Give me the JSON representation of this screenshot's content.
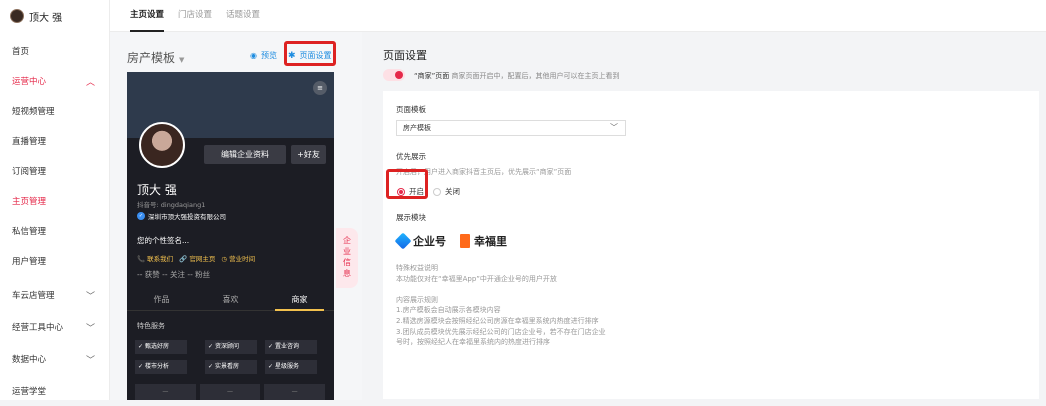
{
  "user": {
    "name": "顶大 强"
  },
  "sidebar": {
    "items": [
      {
        "label": "首页"
      },
      {
        "label": "运营中心",
        "chevron": "up"
      },
      {
        "label": "短视频管理"
      },
      {
        "label": "直播管理"
      },
      {
        "label": "订阅管理"
      },
      {
        "label": "主页管理"
      },
      {
        "label": "私信管理"
      },
      {
        "label": "用户管理"
      },
      {
        "label": "车云店管理",
        "chevron": "down"
      },
      {
        "label": "经营工具中心",
        "chevron": "down"
      },
      {
        "label": "数据中心",
        "chevron": "down"
      },
      {
        "label": "运营学堂"
      }
    ]
  },
  "tabs": [
    {
      "label": "主页设置"
    },
    {
      "label": "门店设置"
    },
    {
      "label": "话题设置"
    }
  ],
  "left": {
    "template_title": "房产模板",
    "preview_label": "预览",
    "page_settings_label": "页面设置"
  },
  "phone": {
    "edit_button": "编辑企业资料",
    "friend_button": "+好友",
    "name": "顶大 强",
    "douyin_id": "抖音号: dingdaqiang1",
    "company": "深圳市顶大强投资有限公司",
    "signature": "您的个性签名...",
    "links": [
      "联系我们",
      "官网主页",
      "营业时间"
    ],
    "stats": "-- 获赞   -- 关注   -- 粉丝",
    "tabs": [
      "作品",
      "喜欢",
      "商家"
    ],
    "services_title": "特色服务",
    "services": [
      "甄选好房",
      "资深顾问",
      "置业咨询",
      "楼市分析",
      "实景看房",
      "星级服务"
    ],
    "bottom_cards": [
      "—",
      "—",
      "—"
    ]
  },
  "side_tag": "企业信息",
  "right": {
    "title": "页面设置",
    "toggle_text_bold": "“商家”页面",
    "toggle_text": "商家页面开启中，配置后，其他用户可以在主页上看到",
    "page_template_label": "页面模板",
    "template_value": "房产模板",
    "priority_label": "优先展示",
    "priority_hint": "开启后，用户进入商家抖音主页后，优先展示“商家”页面",
    "radio_on": "开启",
    "radio_off": "关闭",
    "module_label": "展示模块",
    "logo1": "企业号",
    "logo2": "幸福里",
    "desc_lines": [
      "特殊权益说明",
      "本功能仅对在“幸福里App”中开通企业号的用户开放",
      "",
      "内容展示规则",
      "1.房产模板会自动展示各模块内容",
      "2.精选房源模块会按照经纪公司房源在幸福里系统内热度进行排序",
      "3.团队成员模块优先展示经纪公司的门店企业号，若不存在门店企业",
      "号时，按照经纪人在幸福里系统内的热度进行排序"
    ]
  },
  "colors": {
    "accent": "#e5294a",
    "link": "#1d8ce0",
    "highlight_box": "#dd2222"
  }
}
